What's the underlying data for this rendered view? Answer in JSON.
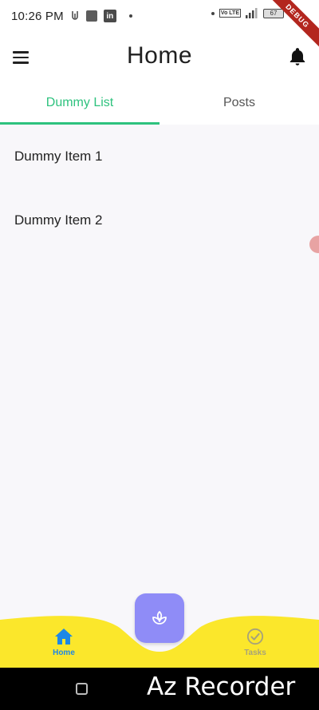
{
  "status_bar": {
    "time": "10:26 PM",
    "linkedin_label": "in",
    "volte_label": "Vo LTE",
    "battery": "67"
  },
  "debug_banner": "DEBUG",
  "app_bar": {
    "title": "Home"
  },
  "tabs": [
    {
      "label": "Dummy List",
      "active": true
    },
    {
      "label": "Posts",
      "active": false
    }
  ],
  "list": {
    "items": [
      {
        "label": "Dummy Item 1"
      },
      {
        "label": "Dummy Item 2"
      }
    ]
  },
  "bottom_nav": {
    "items": [
      {
        "label": "Home",
        "icon": "home-icon",
        "active": true
      },
      {
        "label": "Tasks",
        "icon": "check-circle-icon",
        "active": false
      }
    ],
    "fab_icon": "sprout-icon"
  },
  "watermark": "Az Recorder",
  "colors": {
    "accent": "#2ec27e",
    "nav_background": "#fbe72b",
    "fab": "#8f8cf7",
    "home_active": "#1e88e5"
  }
}
